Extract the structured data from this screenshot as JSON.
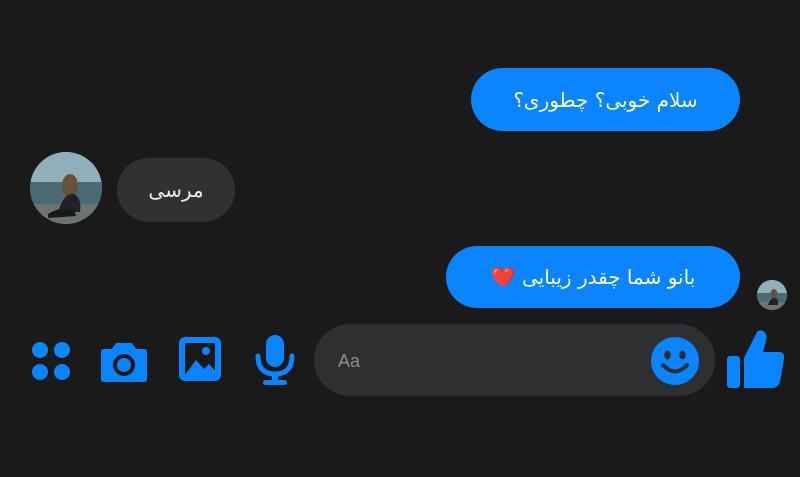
{
  "chat": {
    "messages": [
      {
        "direction": "outgoing",
        "text": "سلام خوبی؟ چطوری؟"
      },
      {
        "direction": "incoming",
        "text": "مرسی"
      },
      {
        "direction": "outgoing",
        "text": "بانو شما چقدر زیبایی ❤️"
      }
    ]
  },
  "composer": {
    "placeholder": "Aa"
  },
  "icons": {
    "apps": "apps-icon",
    "camera": "camera-icon",
    "gallery": "gallery-icon",
    "microphone": "microphone-icon",
    "emoji": "emoji-icon",
    "like": "thumbs-up-icon"
  },
  "colors": {
    "background": "#1a1a1b",
    "accent": "#0a84ff",
    "incoming_bubble": "#303133",
    "composer": "#2e2f31"
  }
}
